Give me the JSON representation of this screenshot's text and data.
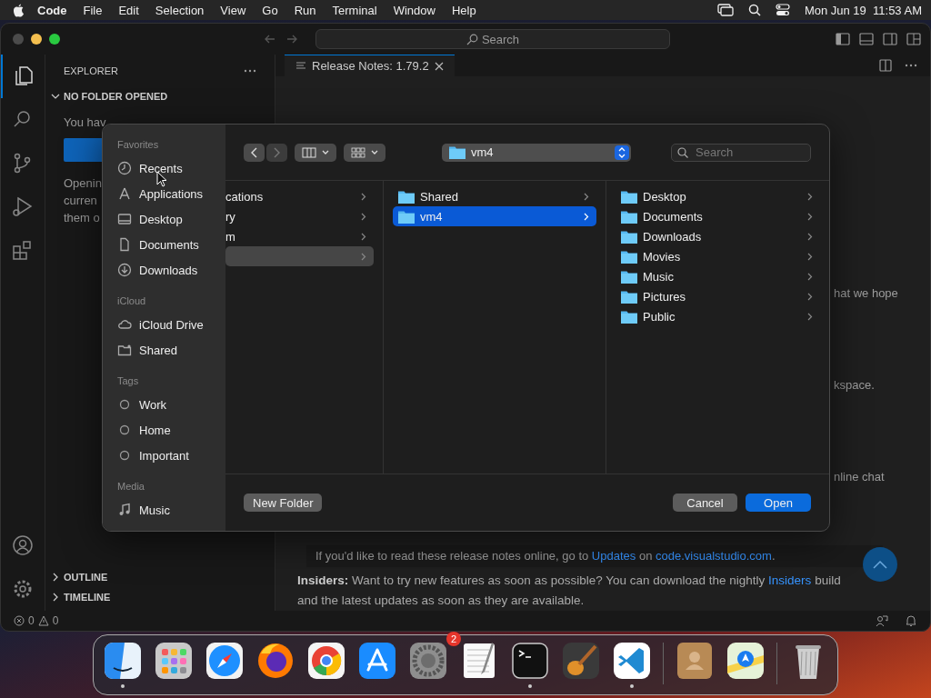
{
  "menubar": {
    "app": "Code",
    "menus": [
      "File",
      "Edit",
      "Selection",
      "View",
      "Go",
      "Run",
      "Terminal",
      "Window",
      "Help"
    ],
    "clock": "Mon Jun 19  11:53 AM"
  },
  "titlebar": {
    "command_center": "Search"
  },
  "activity_bar": [
    {
      "kind": "explorer",
      "selected": true
    },
    {
      "kind": "search",
      "selected": false
    },
    {
      "kind": "source_control",
      "selected": false
    },
    {
      "kind": "run",
      "selected": false
    },
    {
      "kind": "extensions",
      "selected": false
    }
  ],
  "sidebar": {
    "title": "EXPLORER",
    "section": "NO FOLDER OPENED",
    "intro": "You hav",
    "lines": [
      "Openin",
      "curren",
      "them o"
    ],
    "panels": [
      "OUTLINE",
      "TIMELINE"
    ]
  },
  "editor": {
    "tab": {
      "label": "Release Notes: 1.79.2",
      "selected": true
    },
    "fragments": [
      "hat we hope",
      "kspace.",
      "nline chat"
    ],
    "note": [
      {
        "kind": "text",
        "text": "If you'd like to read these release notes online, go to"
      },
      {
        "kind": "link",
        "text": "Updates"
      },
      {
        "kind": "text",
        "text": "on"
      },
      {
        "kind": "link",
        "text": "code.visualstudio.com"
      },
      {
        "kind": "text",
        "text": "."
      }
    ],
    "insiders": [
      {
        "kind": "text",
        "text": "**Insiders:** Want to try new features as soon as possible? You can download the nightly"
      },
      {
        "kind": "link",
        "text": "Insiders"
      },
      {
        "kind": "text",
        "text": "build and the latest updates as soon as they are available."
      }
    ]
  },
  "status_bar": {
    "errors": "0",
    "warnings": "0"
  },
  "dialog": {
    "sidebar": [
      {
        "heading": "Favorites",
        "items": [
          {
            "label": "Recents",
            "kind": "clock"
          },
          {
            "label": "Applications",
            "kind": "apps"
          },
          {
            "label": "Desktop",
            "kind": "desktop"
          },
          {
            "label": "Documents",
            "kind": "document"
          },
          {
            "label": "Downloads",
            "kind": "download"
          }
        ]
      },
      {
        "heading": "iCloud",
        "items": [
          {
            "label": "iCloud Drive",
            "kind": "cloud"
          },
          {
            "label": "Shared",
            "kind": "shared"
          }
        ]
      },
      {
        "heading": "Tags",
        "items": [
          {
            "label": "Work",
            "kind": "tag"
          },
          {
            "label": "Home",
            "kind": "tag"
          },
          {
            "label": "Important",
            "kind": "tag"
          }
        ]
      },
      {
        "heading": "Media",
        "items": [
          {
            "label": "Music",
            "kind": "music"
          }
        ]
      }
    ],
    "path": "vm4",
    "search_placeholder": "Search",
    "columns": [
      [
        {
          "label": "cations",
          "selected": false
        },
        {
          "label": "ry",
          "selected": false
        },
        {
          "label": "m",
          "selected": false
        },
        {
          "selected": true
        }
      ],
      [
        {
          "label": "Shared",
          "selected": false
        },
        {
          "label": "vm4",
          "selected": true
        }
      ],
      [
        {
          "label": "Desktop",
          "selected": false
        },
        {
          "label": "Documents",
          "selected": false
        },
        {
          "label": "Downloads",
          "selected": false
        },
        {
          "label": "Movies",
          "selected": false
        },
        {
          "label": "Music",
          "selected": false
        },
        {
          "label": "Pictures",
          "selected": false
        },
        {
          "label": "Public",
          "selected": false
        }
      ]
    ],
    "new_folder": "New Folder",
    "cancel": "Cancel",
    "open": "Open"
  },
  "dock": {
    "groups": [
      [
        {
          "kind": "finder",
          "running": true
        },
        {
          "kind": "launchpad",
          "running": false
        },
        {
          "kind": "safari",
          "running": false
        },
        {
          "kind": "firefox",
          "running": false
        },
        {
          "kind": "chrome",
          "running": false
        },
        {
          "kind": "appstore",
          "running": false
        },
        {
          "kind": "settings",
          "running": false,
          "badge": "2"
        },
        {
          "kind": "textedit",
          "running": false
        },
        {
          "kind": "terminal",
          "running": true
        },
        {
          "kind": "garageband",
          "running": false
        },
        {
          "kind": "vscode",
          "running": true
        }
      ],
      [
        {
          "kind": "contacts",
          "running": false
        },
        {
          "kind": "maps",
          "running": false
        }
      ],
      [
        {
          "kind": "trash",
          "running": false
        }
      ]
    ]
  }
}
